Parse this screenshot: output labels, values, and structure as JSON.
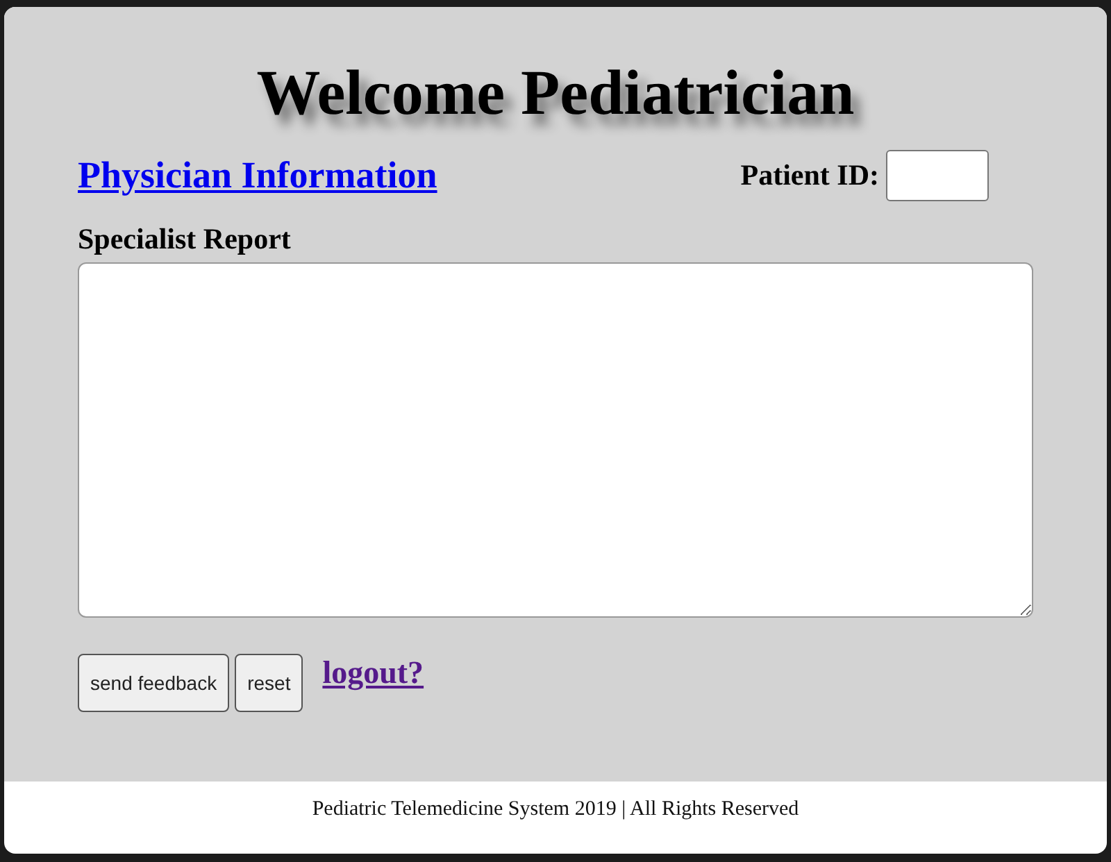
{
  "title": "Welcome Pediatrician",
  "physician_link": "Physician Information",
  "patient_id": {
    "label": "Patient ID:"
  },
  "report": {
    "label": "Specialist Report"
  },
  "buttons": [
    "send feedback",
    "reset"
  ],
  "logout_link": "logout?",
  "footer": "Pediatric Telemedicine System 2019 | All Rights Reserved"
}
